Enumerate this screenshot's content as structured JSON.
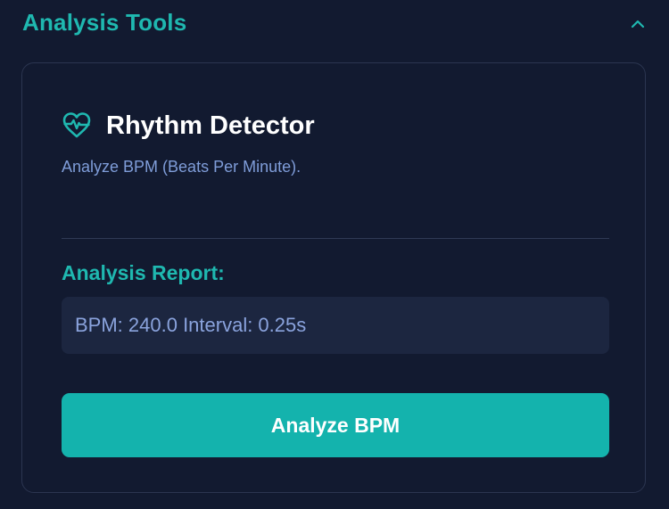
{
  "section": {
    "title": "Analysis Tools",
    "toggle_icon": "chevron-up-icon"
  },
  "tool": {
    "title": "Rhythm Detector",
    "icon": "heart-pulse-icon",
    "description": "Analyze BPM (Beats Per Minute)."
  },
  "report": {
    "label": "Analysis Report:",
    "text": "BPM: 240.0 Interval: 0.25s"
  },
  "actions": {
    "analyze_label": "Analyze BPM"
  },
  "colors": {
    "background": "#121a30",
    "accent": "#1fb8b0",
    "button": "#14b3ad",
    "card_border": "#2b3550",
    "report_bg": "#1c2640",
    "description": "#7f9dd9"
  }
}
